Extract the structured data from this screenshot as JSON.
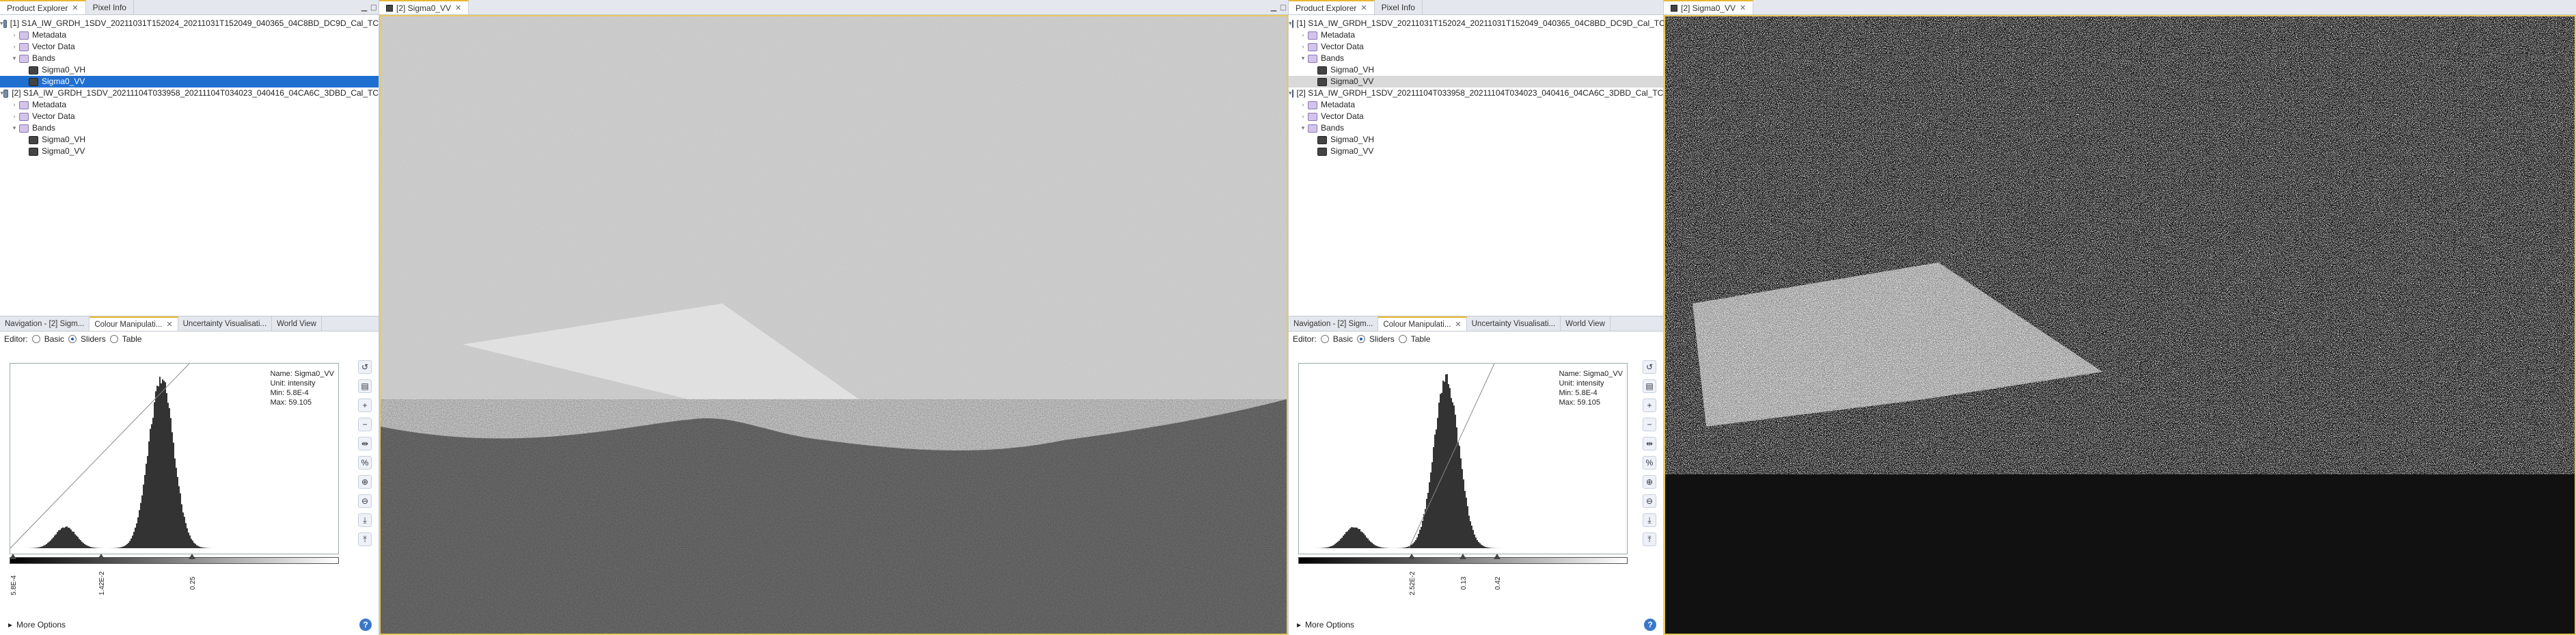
{
  "left": {
    "tabs": [
      "Product Explorer",
      "Pixel Info"
    ],
    "products": [
      {
        "label": "[1] S1A_IW_GRDH_1SDV_20211031T152024_20211031T152049_040365_04C8BD_DC9D_Cal_TC",
        "children": [
          "Metadata",
          "Vector Data",
          "Bands"
        ],
        "bands": [
          "Sigma0_VH",
          "Sigma0_VV"
        ]
      },
      {
        "label": "[2] S1A_IW_GRDH_1SDV_20211104T033958_20211104T034023_040416_04CA6C_3DBD_Cal_TC",
        "children": [
          "Metadata",
          "Vector Data",
          "Bands"
        ],
        "bands": [
          "Sigma0_VH",
          "Sigma0_VV"
        ]
      }
    ],
    "tool_tabs": [
      "Navigation - [2] Sigm...",
      "Colour Manipulati...",
      "Uncertainty Visualisati...",
      "World View"
    ],
    "editor_label": "Editor:",
    "editor_options": [
      "Basic",
      "Sliders",
      "Table"
    ],
    "info": {
      "name": "Name: Sigma0_VV",
      "unit": "Unit: intensity",
      "min": "Min: 5.8E-4",
      "max": "Max: 59.105"
    },
    "slider_labels": [
      "5.8E-4",
      "1.42E-2",
      "0.25"
    ],
    "more_options": "More Options",
    "help": "?"
  },
  "mid": {
    "tab": "[2] Sigma0_VV"
  },
  "right": {
    "tabs": [
      "Product Explorer",
      "Pixel Info"
    ],
    "tool_tabs": [
      "Navigation - [2] Sigm...",
      "Colour Manipulati...",
      "Uncertainty Visualisati...",
      "World View"
    ],
    "slider_labels": [
      "2.52E-2",
      "0.13",
      "0.42"
    ]
  },
  "far": {
    "tab": "[2] Sigma0_VV"
  },
  "colors": {
    "accent": "#e8b730",
    "selection": "#1f6fd1"
  }
}
